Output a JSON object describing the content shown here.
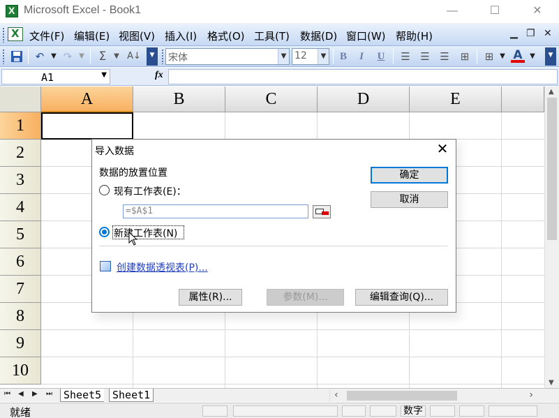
{
  "window": {
    "title": "Microsoft Excel - Book1",
    "min": "—",
    "max": "☐",
    "close": "✕"
  },
  "menu": {
    "items": [
      "文件(F)",
      "编辑(E)",
      "视图(V)",
      "插入(I)",
      "格式(O)",
      "工具(T)",
      "数据(D)",
      "窗口(W)",
      "帮助(H)"
    ],
    "mdi_min": "▁",
    "mdi_restore": "❐",
    "mdi_close": "✕"
  },
  "toolbar": {
    "font_name": "宋体",
    "font_size": "12",
    "bold": "B",
    "italic": "I",
    "underline": "U",
    "font_color_letter": "A",
    "font_color": "#e00000"
  },
  "formula_bar": {
    "name_box": "A1",
    "fx": "fx",
    "formula": ""
  },
  "grid": {
    "columns": [
      "A",
      "B",
      "C",
      "D",
      "E"
    ],
    "rows": [
      "1",
      "2",
      "3",
      "4",
      "5",
      "6",
      "7",
      "8",
      "9",
      "10"
    ],
    "active_cell": "A1"
  },
  "sheets": {
    "tabs": [
      "Sheet5",
      "Sheet1"
    ]
  },
  "status": {
    "ready": "就绪",
    "num_mode": "数字"
  },
  "dialog": {
    "title": "导入数据",
    "section_label": "数据的放置位置",
    "existing_sheet_label": "现有工作表(E)：",
    "existing_ref": "=$A$1",
    "new_sheet_label": "新建工作表(N)",
    "new_sheet_checked": true,
    "pivot_link": "创建数据透视表(P)...",
    "ok": "确定",
    "cancel": "取消",
    "properties": "属性(R)...",
    "parameters": "参数(M)...",
    "edit_query": "编辑查询(Q)..."
  }
}
